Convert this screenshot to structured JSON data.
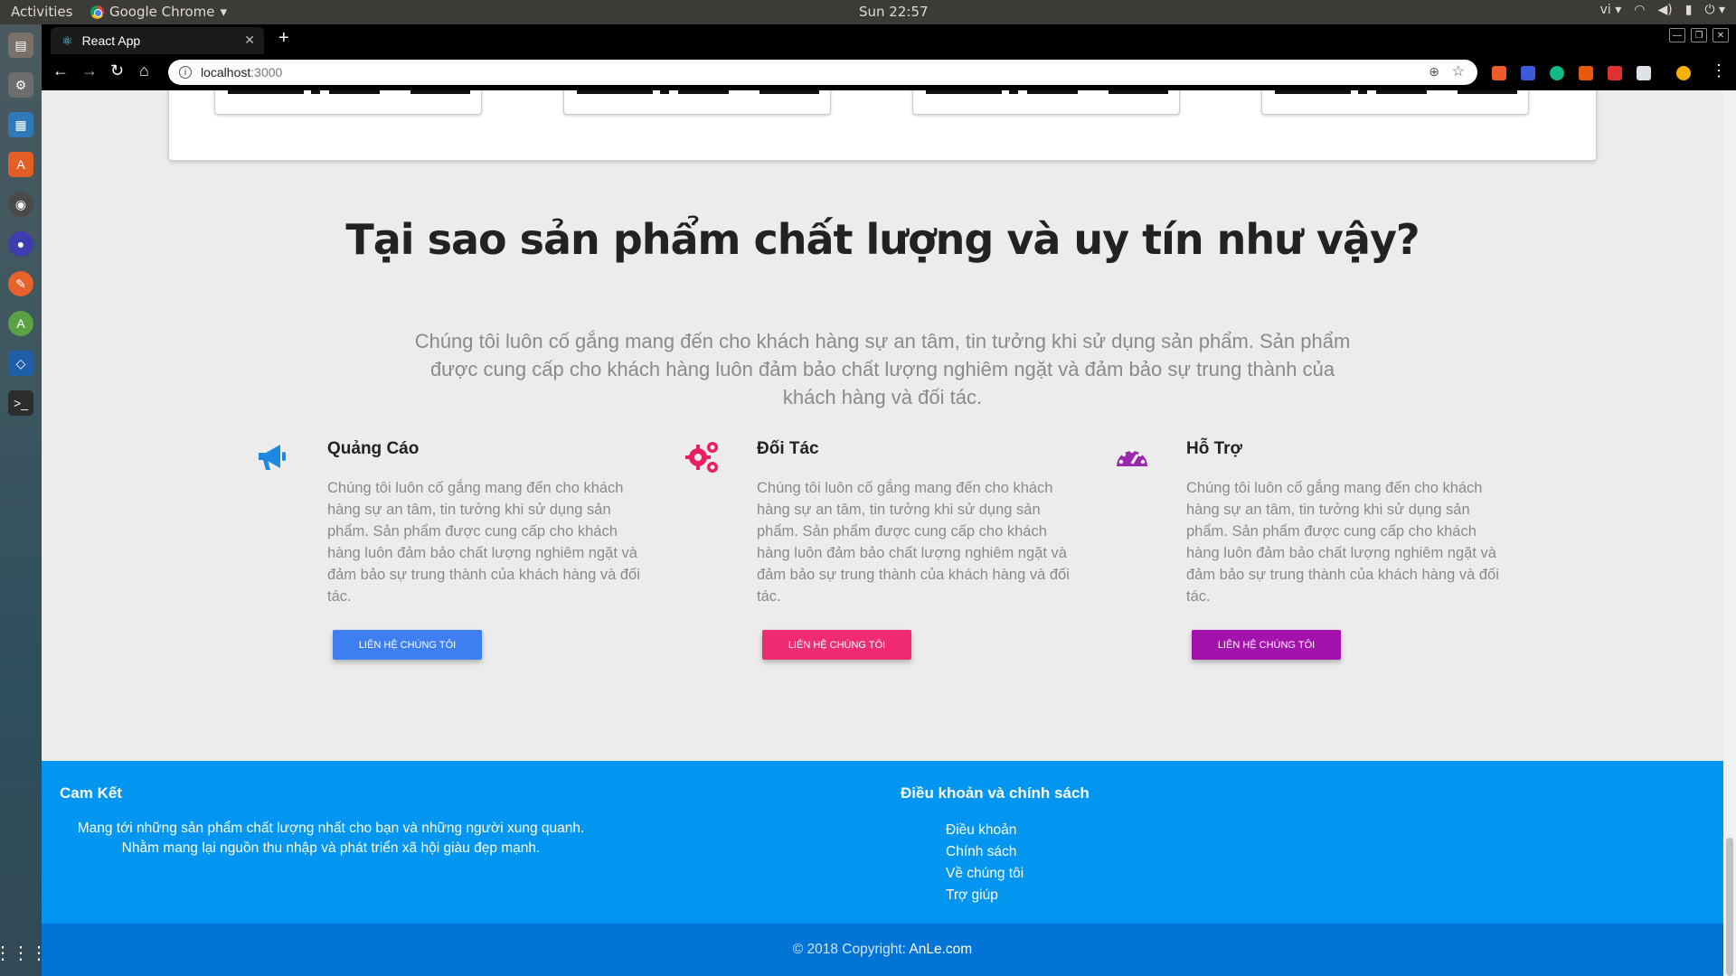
{
  "os": {
    "activities": "Activities",
    "app_name": "Google Chrome",
    "clock": "Sun 22:57",
    "lang": "vi"
  },
  "browser": {
    "tab_title": "React App",
    "url_host": "localhost",
    "url_port": ":3000"
  },
  "why": {
    "title": "Tại sao sản phẩm chất lượng và uy tín như vậy?",
    "description": "Chúng tôi luôn cố gắng mang đến cho khách hàng sự an tâm, tin tưởng khi sử dụng sản phẩm. Sản phẩm được cung cấp cho khách hàng luôn đảm bảo chất lượng nghiêm ngặt và đảm bảo sự trung thành của khách hàng và đối tác."
  },
  "features": [
    {
      "icon": "megaphone-icon",
      "color": "#1e88e5",
      "title": "Quảng Cáo",
      "text": "Chúng tôi luôn cố gắng mang đến cho khách hàng sự an tâm, tin tưởng khi sử dụng sản phẩm. Sản phẩm được cung cấp cho khách hàng luôn đảm bảo chất lượng nghiêm ngặt và đảm bảo sự trung thành của khách hàng và đối tác.",
      "button": "LIÊN HỆ CHÚNG TÔI",
      "button_color": "#3d7ff0"
    },
    {
      "icon": "gears-icon",
      "color": "#e91e63",
      "title": "Đối Tác",
      "text": "Chúng tôi luôn cố gắng mang đến cho khách hàng sự an tâm, tin tưởng khi sử dụng sản phẩm. Sản phẩm được cung cấp cho khách hàng luôn đảm bảo chất lượng nghiêm ngặt và đảm bảo sự trung thành của khách hàng và đối tác.",
      "button": "LIÊN HỆ CHÚNG TÔI",
      "button_color": "#f02b74"
    },
    {
      "icon": "dashboard-icon",
      "color": "#9c27b0",
      "title": "Hỗ Trợ",
      "text": "Chúng tôi luôn cố gắng mang đến cho khách hàng sự an tâm, tin tưởng khi sử dụng sản phẩm. Sản phẩm được cung cấp cho khách hàng luôn đảm bảo chất lượng nghiêm ngặt và đảm bảo sự trung thành của khách hàng và đối tác.",
      "button": "LIÊN HỆ CHÚNG TÔI",
      "button_color": "#a412ad"
    }
  ],
  "footer": {
    "commit_title": "Cam Kết",
    "commit_text": "Mang tới những sản phẩm chất lượng nhất cho bạn và những người xung quanh. Nhằm mang lại nguồn thu nhập và phát triển xã hội giàu đẹp mạnh.",
    "policy_title": "Điều khoản và chính sách",
    "links": [
      "Điều khoản",
      "Chính sách",
      "Về chúng tôi",
      "Trợ giúp"
    ],
    "copyright_prefix": "© 2018 Copyright: ",
    "copyright_brand": "AnLe.com",
    "bg_color": "#0396f0",
    "bottom_color": "#0274d6"
  }
}
